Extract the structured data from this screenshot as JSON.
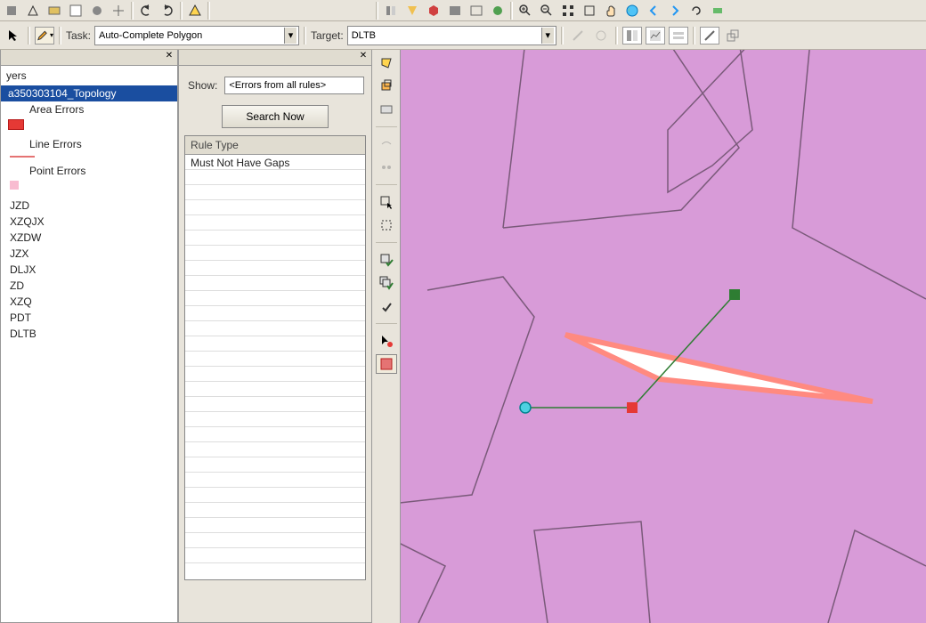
{
  "toolbar": {
    "task_label": "Task:",
    "task_value": "Auto-Complete Polygon",
    "target_label": "Target:",
    "target_value": "DLTB"
  },
  "layers_panel": {
    "title": "yers",
    "selected": "a350303104_Topology",
    "area_errors": "Area Errors",
    "line_errors": "Line Errors",
    "point_errors": "Point Errors",
    "layers": [
      "JZD",
      "XZQJX",
      "XZDW",
      "JZX",
      "DLJX",
      "ZD",
      "XZQ",
      "PDT",
      "DLTB"
    ]
  },
  "error_panel": {
    "show_label": "Show:",
    "show_value": "<Errors from all rules>",
    "search_btn": "Search Now",
    "rule_header": "Rule Type",
    "rule_row1": "Must Not Have Gaps"
  },
  "icons": {
    "pointer": "pointer",
    "pencil": "pencil"
  }
}
